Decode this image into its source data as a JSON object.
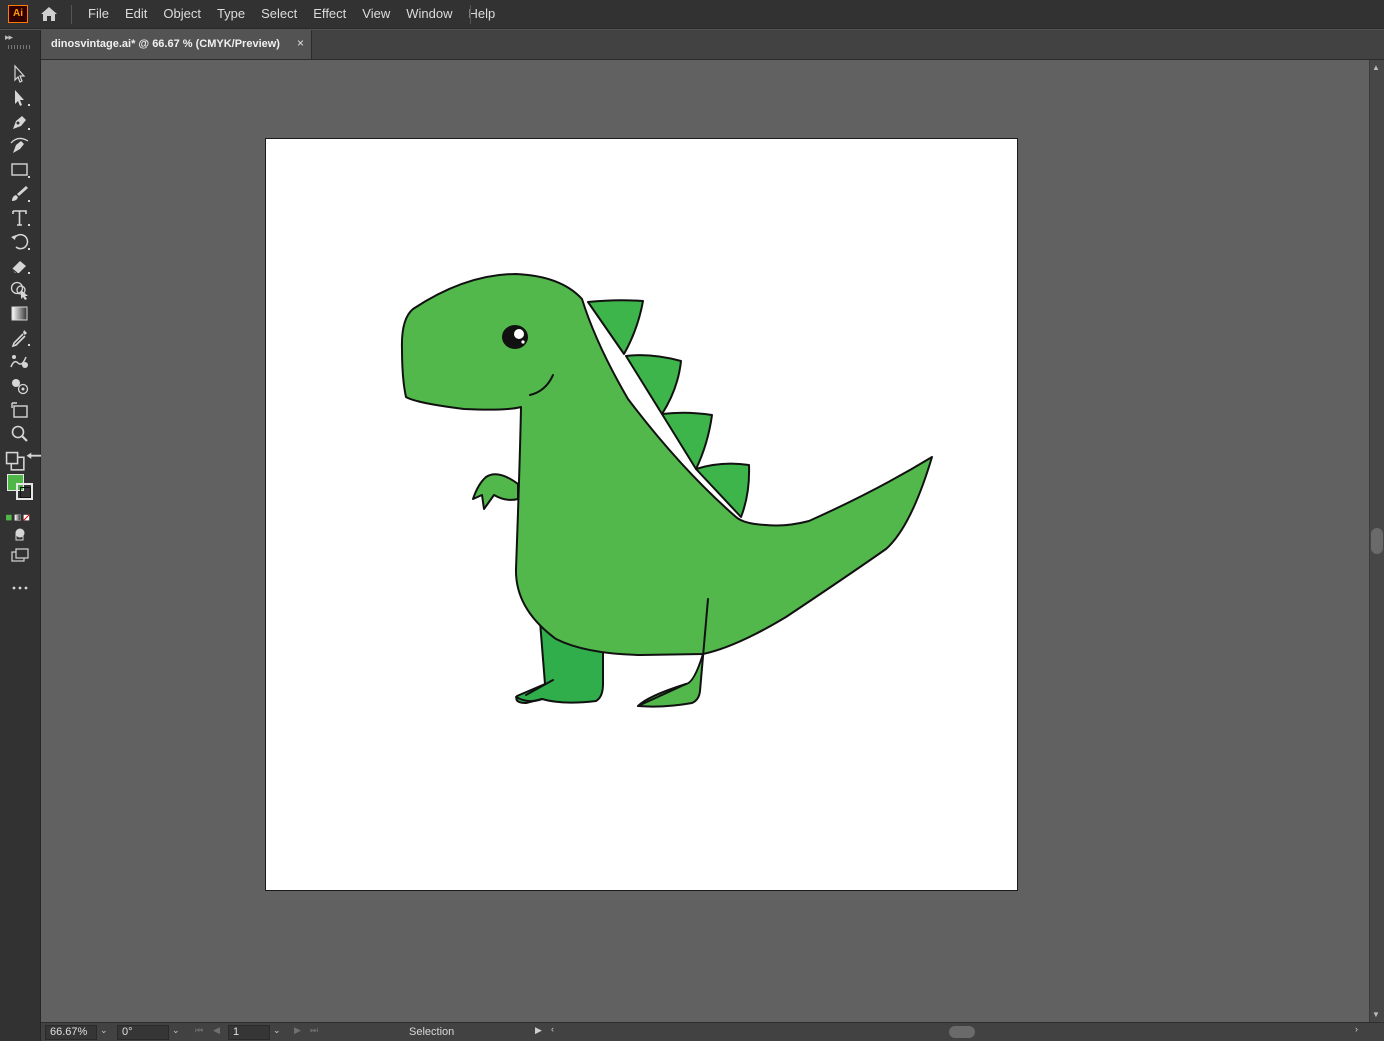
{
  "app": {
    "logo_text": "Ai",
    "accent": "#ff9a00"
  },
  "menu": {
    "items": [
      "File",
      "Edit",
      "Object",
      "Type",
      "Select",
      "Effect",
      "View",
      "Window",
      "Help"
    ]
  },
  "document": {
    "tab_title": "dinosvintage.ai* @ 66.67 % (CMYK/Preview)",
    "close_glyph": "×"
  },
  "tools": [
    {
      "name": "selection-tool-icon"
    },
    {
      "name": "direct-selection-tool-icon"
    },
    {
      "name": "pen-tool-icon"
    },
    {
      "name": "curvature-tool-icon"
    },
    {
      "name": "rectangle-tool-icon"
    },
    {
      "name": "paintbrush-tool-icon"
    },
    {
      "name": "type-tool-icon"
    },
    {
      "name": "rotate-tool-icon"
    },
    {
      "name": "eraser-tool-icon"
    },
    {
      "name": "shape-builder-tool-icon"
    },
    {
      "name": "gradient-tool-icon"
    },
    {
      "name": "eyedropper-tool-icon"
    },
    {
      "name": "puppet-warp-tool-icon"
    },
    {
      "name": "symbol-sprayer-tool-icon"
    },
    {
      "name": "artboard-tool-icon"
    },
    {
      "name": "zoom-tool-icon"
    }
  ],
  "colors": {
    "fill": "#4fb748",
    "dino_body": "#52b84b",
    "dino_dark": "#2fae4b",
    "dino_spikes": "#3db54a",
    "artboard": "#ffffff",
    "canvas": "#616161"
  },
  "status": {
    "zoom": "66.67%",
    "rotation": "0°",
    "artboard_number": "1",
    "tool_name": "Selection"
  }
}
